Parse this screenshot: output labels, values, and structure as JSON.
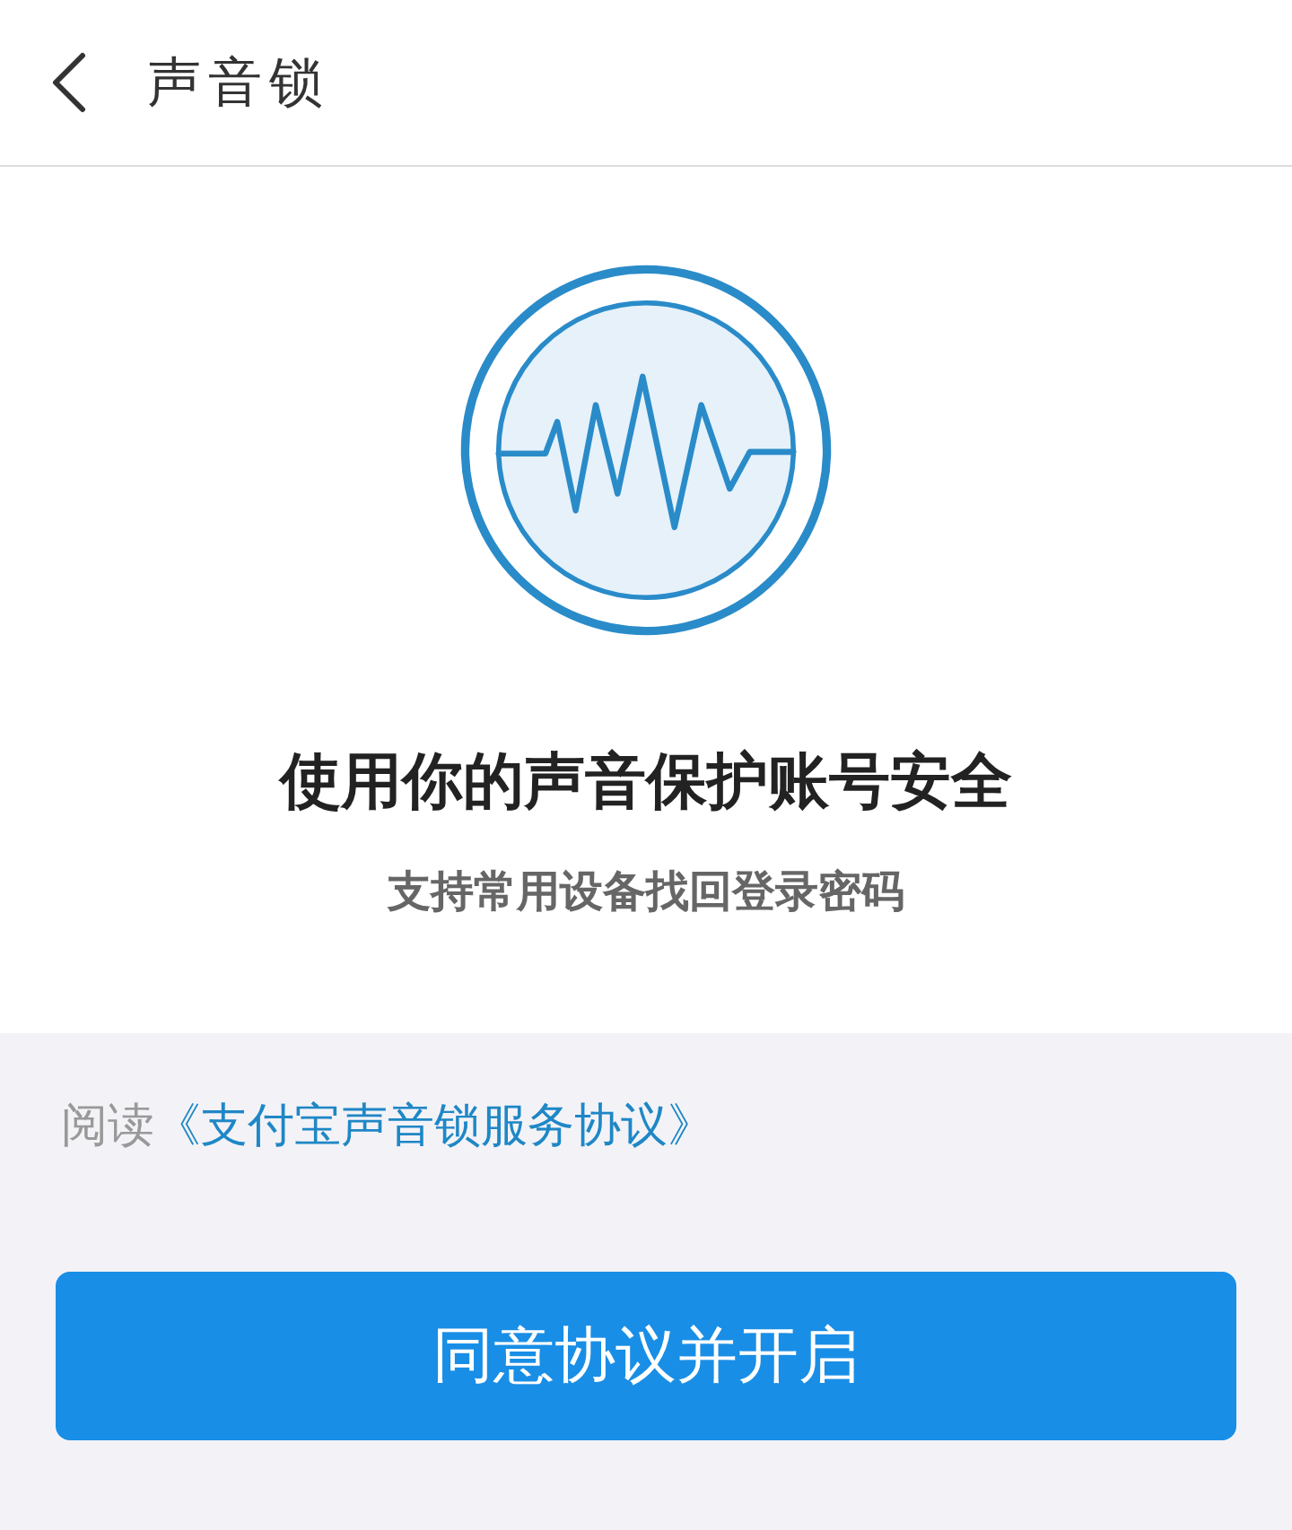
{
  "header": {
    "title": "声音锁"
  },
  "intro": {
    "title": "使用你的声音保护账号安全",
    "subtitle": "支持常用设备找回登录密码"
  },
  "agreement": {
    "prefix": "阅读",
    "link": "《支付宝声音锁服务协议》"
  },
  "buttons": [
    "同意协议并开启"
  ]
}
